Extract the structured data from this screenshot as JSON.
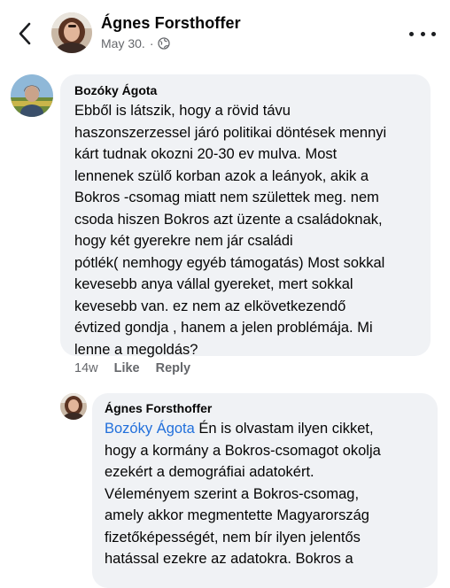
{
  "header": {
    "name": "Ágnes Forsthoffer",
    "date": "May 30.",
    "separator": "·"
  },
  "comment": {
    "author": "Bozóky Ágota",
    "text": "Ebből is látszik, hogy a rövid távu\nhaszonszerzessel járó politikai döntések mennyi\nkárt tudnak okozni 20-30 ev mulva. Most\nlennenek szülő korban azok a leányok, akik a\nBokros -csomag miatt nem születtek meg. nem\ncsoda hiszen Bokros azt üzente a családoknak,\nhogy két gyerekre nem jár családi\npótlék( nemhogy egyéb támogatás) Most sokkal\nkevesebb anya vállal gyereket, mert sokkal\nkevesebb van.  ez nem az elkövetkezendő\névtized gondja , hanem a jelen problémája. Mi\nlenne a megoldás?",
    "time": "14w",
    "like_label": "Like",
    "reply_label": "Reply"
  },
  "reply": {
    "author": "Ágnes Forsthoffer",
    "mention": "Bozóky Ágota",
    "text": " Én is olvastam ilyen cikket,\nhogy a kormány a Bokros-csomagot okolja\nezekért a demográfiai adatokért.\nVéleményem szerint a Bokros-csomag,\namely akkor megmentette Magyarország\nfizetőképességét, nem bír ilyen jelentős\nhatással ezekre az adatokra. Bokros a"
  },
  "colors": {
    "bubble": "#f0f2f5",
    "mention": "#216fdb",
    "meta": "#65676b"
  },
  "icons": [
    "back-chevron-icon",
    "globe-icon",
    "more-dots-icon"
  ]
}
